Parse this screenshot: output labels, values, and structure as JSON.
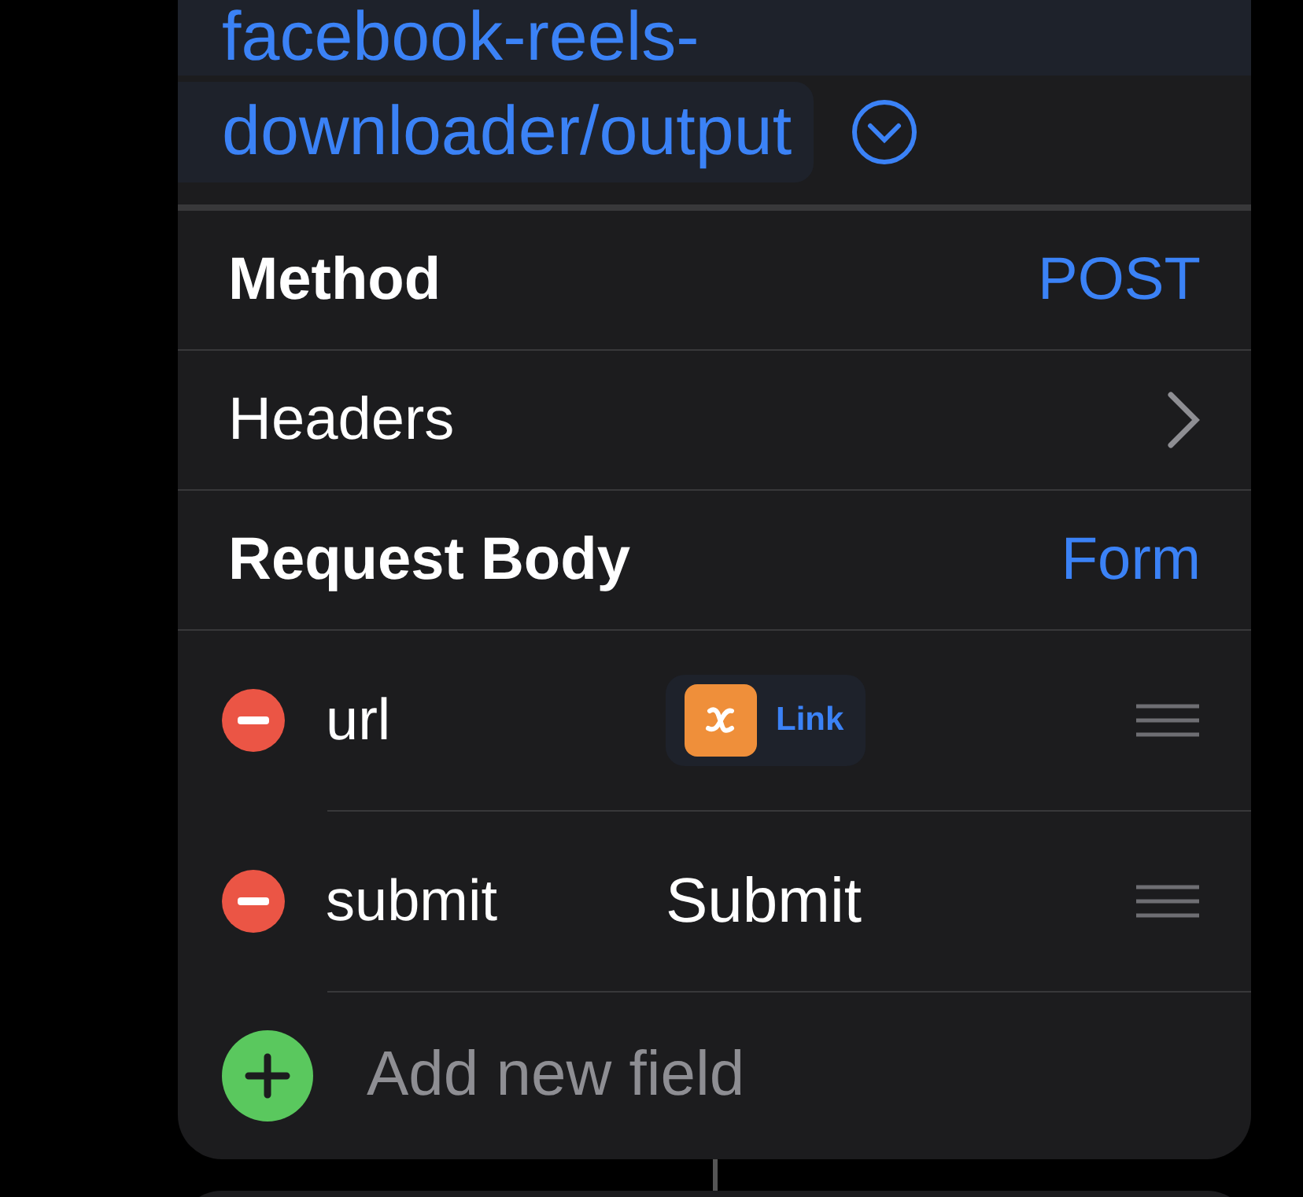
{
  "url": {
    "lines": [
      "facebook-reels-",
      "downloader/output"
    ]
  },
  "settings": [
    {
      "kind": "value",
      "label": "Method",
      "value": "POST",
      "bold": true
    },
    {
      "kind": "link",
      "label": "Headers",
      "bold": false
    },
    {
      "kind": "value",
      "label": "Request Body",
      "value": "Form",
      "bold": true
    }
  ],
  "fields": [
    {
      "key": "url",
      "kind": "variable",
      "value": "Link"
    },
    {
      "key": "submit",
      "kind": "text",
      "value": "Submit"
    }
  ],
  "add_field": {
    "placeholder": "Add new field"
  }
}
